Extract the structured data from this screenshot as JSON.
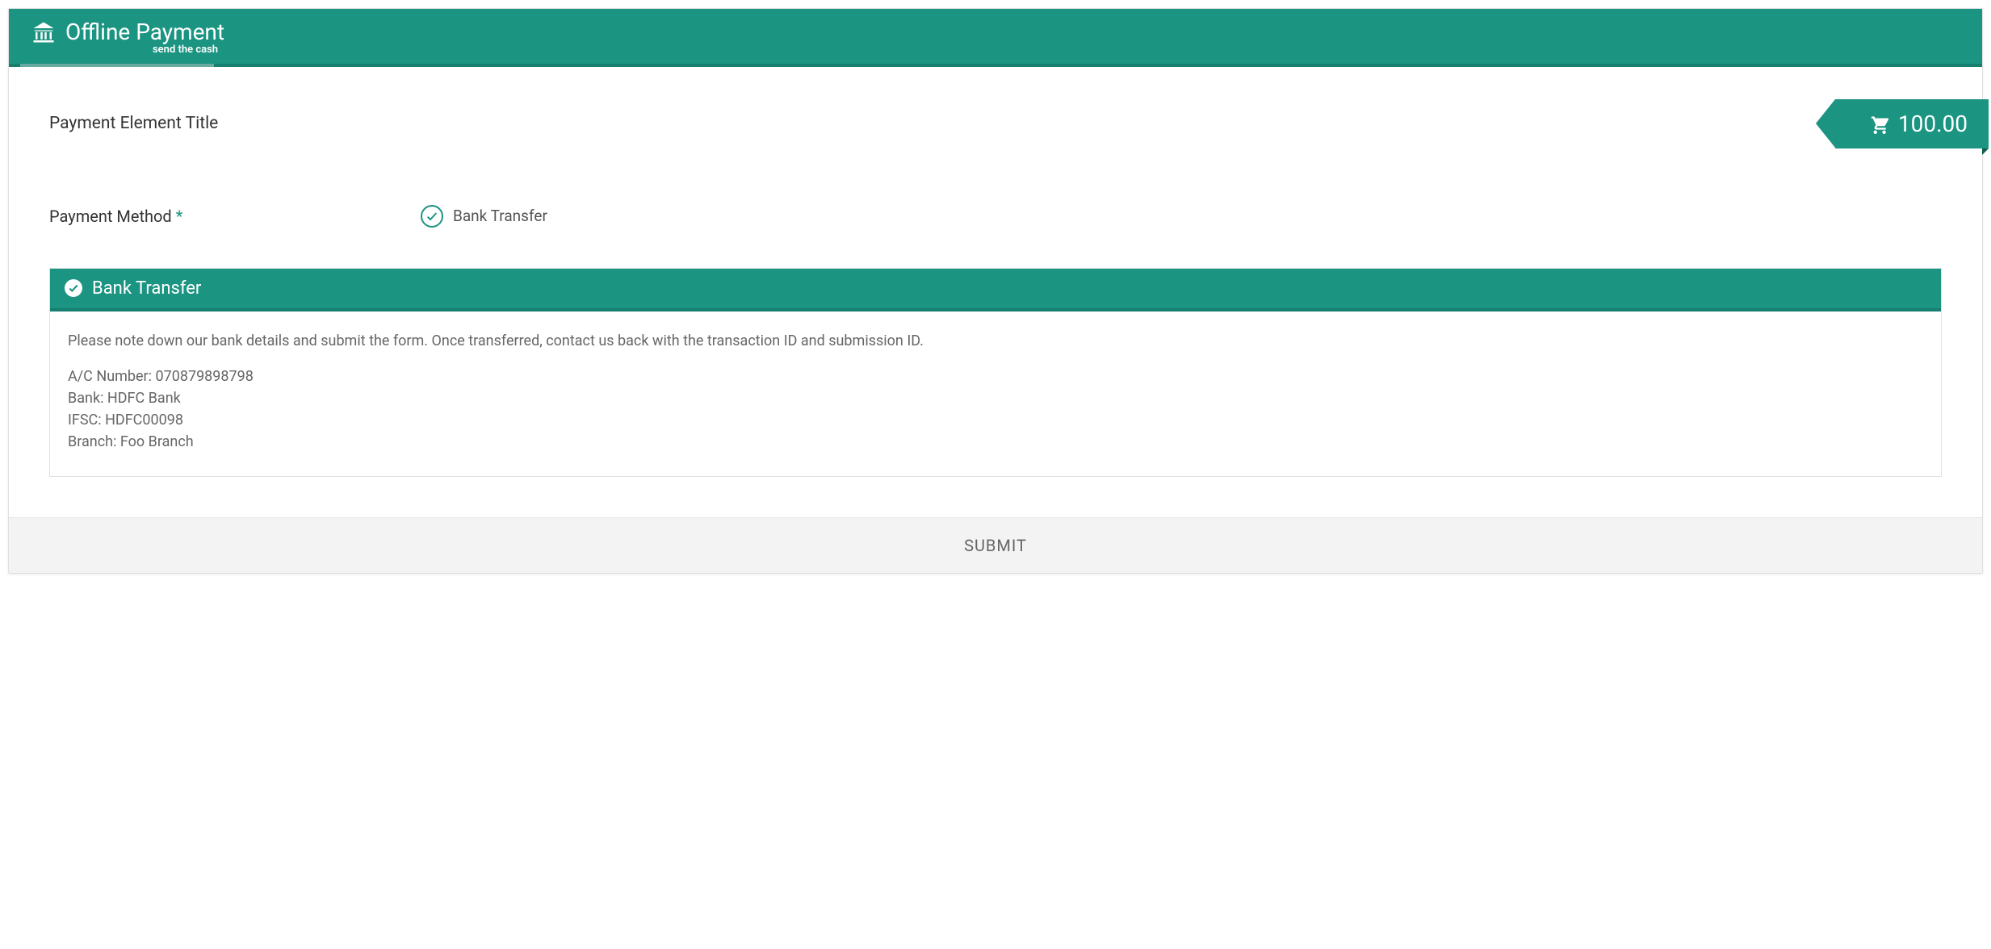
{
  "header": {
    "title": "Offline Payment",
    "subtitle": "send the cash"
  },
  "form": {
    "title_label": "Payment Element Title",
    "amount": "100.00",
    "payment_method_label": "Payment Method",
    "required_mark": "*",
    "options": [
      {
        "label": "Bank Transfer",
        "selected": true
      }
    ]
  },
  "panel": {
    "title": "Bank Transfer",
    "intro": "Please note down our bank details and submit the form. Once transferred, contact us back with the transaction ID and submission ID.",
    "details": {
      "ac_label": "A/C Number:",
      "ac_value": "070879898798",
      "bank_label": "Bank:",
      "bank_value": "HDFC Bank",
      "ifsc_label": "IFSC:",
      "ifsc_value": "HDFC00098",
      "branch_label": "Branch:",
      "branch_value": "Foo Branch"
    }
  },
  "footer": {
    "submit_label": "SUBMIT"
  }
}
